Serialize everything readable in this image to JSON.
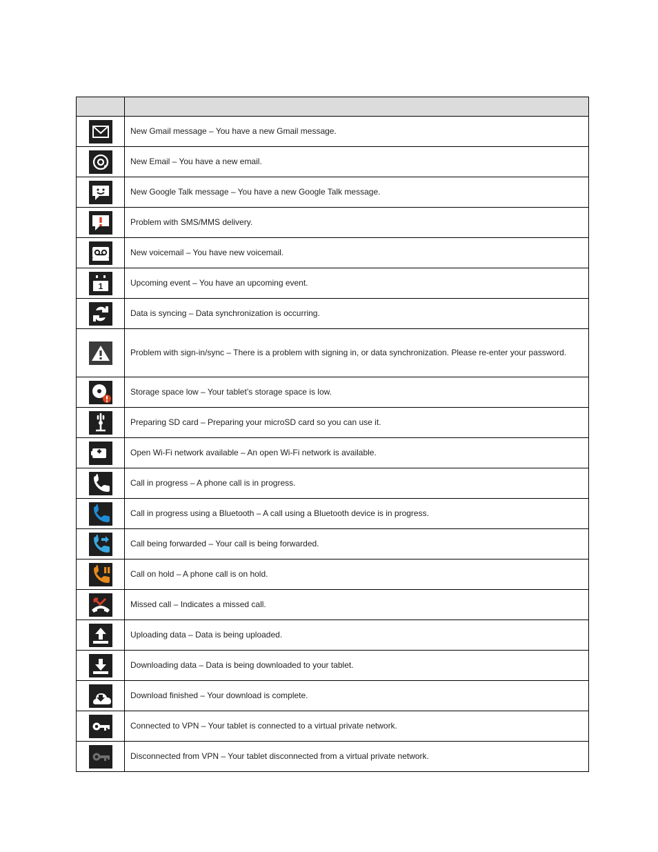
{
  "table": {
    "header_icon": "",
    "header_desc": "",
    "rows": [
      {
        "icon": "gmail",
        "name": "gmail-icon",
        "desc": "New Gmail message – You have a new Gmail message."
      },
      {
        "icon": "email-at",
        "name": "email-icon",
        "desc": "New Email – You have a new email."
      },
      {
        "icon": "gtalk",
        "name": "google-talk-icon",
        "desc": "New Google Talk message – You have a new Google Talk message."
      },
      {
        "icon": "sms-alert",
        "name": "sms-problem-icon",
        "desc": "Problem with SMS/MMS delivery."
      },
      {
        "icon": "voicemail",
        "name": "voicemail-icon",
        "desc": "New voicemail – You have new voicemail."
      },
      {
        "icon": "calendar",
        "name": "calendar-event-icon",
        "desc": "Upcoming event – You have an upcoming event."
      },
      {
        "icon": "sync",
        "name": "data-sync-icon",
        "desc": "Data is syncing – Data synchronization is occurring."
      },
      {
        "icon": "warning",
        "name": "sign-in-error-icon",
        "desc": "Problem with sign-in/sync – There is a problem with signing in, or data synchronization. Please re-enter your password."
      },
      {
        "icon": "disk-full",
        "name": "low-storage-icon",
        "desc": "Storage space low – Your tablet’s storage space is low."
      },
      {
        "icon": "mic-sdcard",
        "name": "sd-preparing-icon",
        "desc": "Preparing SD card – Preparing your microSD card so you can use it."
      },
      {
        "icon": "wifi-plus",
        "name": "wifi-available-icon",
        "desc": "Open Wi-Fi network available – An open Wi-Fi network is available."
      },
      {
        "icon": "call-white",
        "name": "call-progress-icon",
        "desc": "Call in progress – A phone call is in progress."
      },
      {
        "icon": "call-blue",
        "name": "bluetooth-call-icon",
        "desc": "Call in progress using a Bluetooth – A call using a Bluetooth device is in progress."
      },
      {
        "icon": "call-fwd",
        "name": "call-forward-icon",
        "desc": "Call being forwarded – Your call is being forwarded."
      },
      {
        "icon": "call-hold",
        "name": "call-hold-icon",
        "desc": "Call on hold – A phone call is on hold."
      },
      {
        "icon": "missed-call",
        "name": "missed-call-icon",
        "desc": "Missed call – Indicates a missed call."
      },
      {
        "icon": "upload",
        "name": "uploading-icon",
        "desc": "Uploading data – Data is being uploaded."
      },
      {
        "icon": "download",
        "name": "downloading-icon",
        "desc": "Downloading data – Data is being downloaded to your tablet."
      },
      {
        "icon": "download-done",
        "name": "download-finished-icon",
        "desc": "Download finished – Your download is complete."
      },
      {
        "icon": "vpn-on",
        "name": "vpn-connected-icon",
        "desc": "Connected to VPN – Your tablet is connected to a virtual private network."
      },
      {
        "icon": "vpn-off",
        "name": "vpn-disconnected-icon",
        "desc": "Disconnected from VPN – Your tablet disconnected from a virtual private network."
      }
    ]
  },
  "footer": {
    "left": "",
    "right": ""
  }
}
